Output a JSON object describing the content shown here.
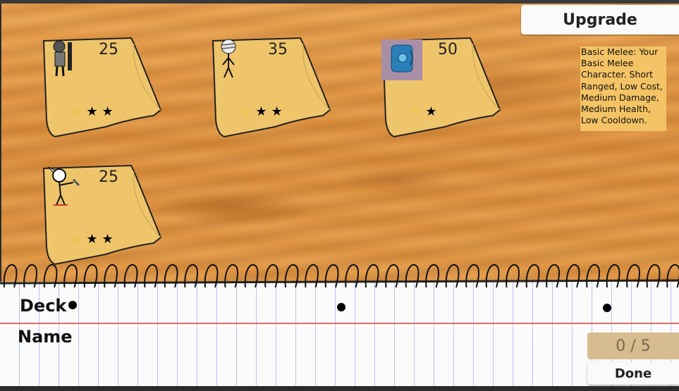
{
  "cards": [
    {
      "cost": "25",
      "character": "armored-knight",
      "stars_total": 3,
      "stars_gold": 1
    },
    {
      "cost": "35",
      "character": "bandaged-mummy",
      "stars_total": 3,
      "stars_gold": 1
    },
    {
      "cost": "50",
      "character": "blue-backpack",
      "stars_total": 2,
      "stars_gold": 1
    },
    {
      "cost": "25",
      "character": "feather-archer",
      "stars_total": 3,
      "stars_gold": 1
    }
  ],
  "upgrade": {
    "label": "Upgrade"
  },
  "description": {
    "text": "Basic Melee: Your Basic Melee Character. Short Ranged, Low Cost, Medium Damage, Medium Health, Low Cooldown."
  },
  "deck": {
    "label_deck": "Deck",
    "label_name": "Name",
    "count": "0 / 5",
    "done_label": "Done"
  },
  "colors": {
    "note": "#efc56c",
    "wood": "#e19744",
    "gold_star": "#e4c200",
    "margin_line": "#e26a6a"
  }
}
